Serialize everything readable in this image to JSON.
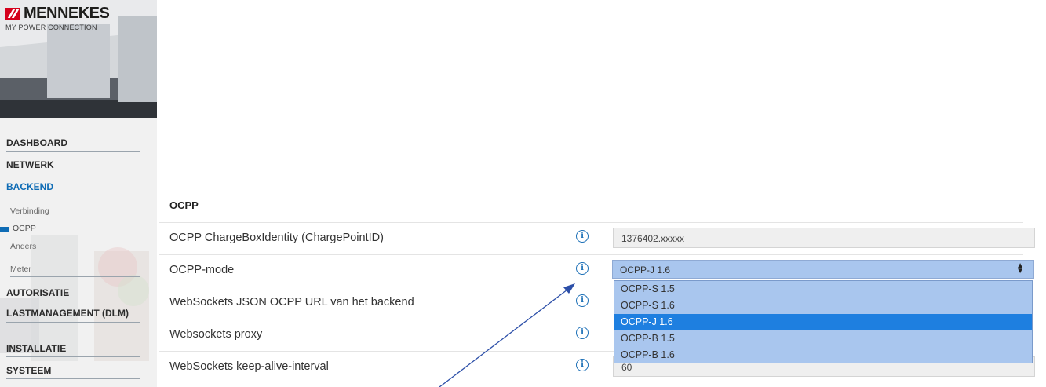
{
  "brand": {
    "name": "MENNEKES",
    "tagline": "MY POWER CONNECTION",
    "accent": "#d5001c"
  },
  "sidebar": {
    "main_items": [
      {
        "label": "DASHBOARD"
      },
      {
        "label": "NETWERK"
      },
      {
        "label": "BACKEND",
        "active": true
      },
      {
        "label": "AUTORISATIE"
      },
      {
        "label": "LASTMANAGEMENT (DLM)"
      },
      {
        "label": "INSTALLATIE"
      },
      {
        "label": "SYSTEEM"
      }
    ],
    "sub_items": [
      {
        "label": "Verbinding"
      },
      {
        "label": "OCPP",
        "active": true
      },
      {
        "label": "Anders"
      },
      {
        "label": "Meter"
      }
    ],
    "active_color": "#0f6cb5"
  },
  "section": {
    "title": "OCPP"
  },
  "rows": [
    {
      "label": "OCPP ChargeBoxIdentity (ChargePointID)",
      "value": "1376402.xxxxx"
    },
    {
      "label": "OCPP-mode",
      "value": "OCPP-J 1.6"
    },
    {
      "label": "WebSockets JSON OCPP URL van het backend"
    },
    {
      "label": "Websockets proxy"
    },
    {
      "label": "WebSockets keep-alive-interval",
      "value": "60"
    }
  ],
  "ocpp_mode_select": {
    "selected": "OCPP-J 1.6",
    "options": [
      "OCPP-S 1.5",
      "OCPP-S 1.6",
      "OCPP-J 1.6",
      "OCPP-B 1.5",
      "OCPP-B 1.6"
    ]
  },
  "icons": {
    "info": "info-circle-icon",
    "select_arrows": "sort-arrows-icon"
  },
  "info_glyph": "i",
  "arrow_glyphs": {
    "up": "▲",
    "down": "▼"
  }
}
